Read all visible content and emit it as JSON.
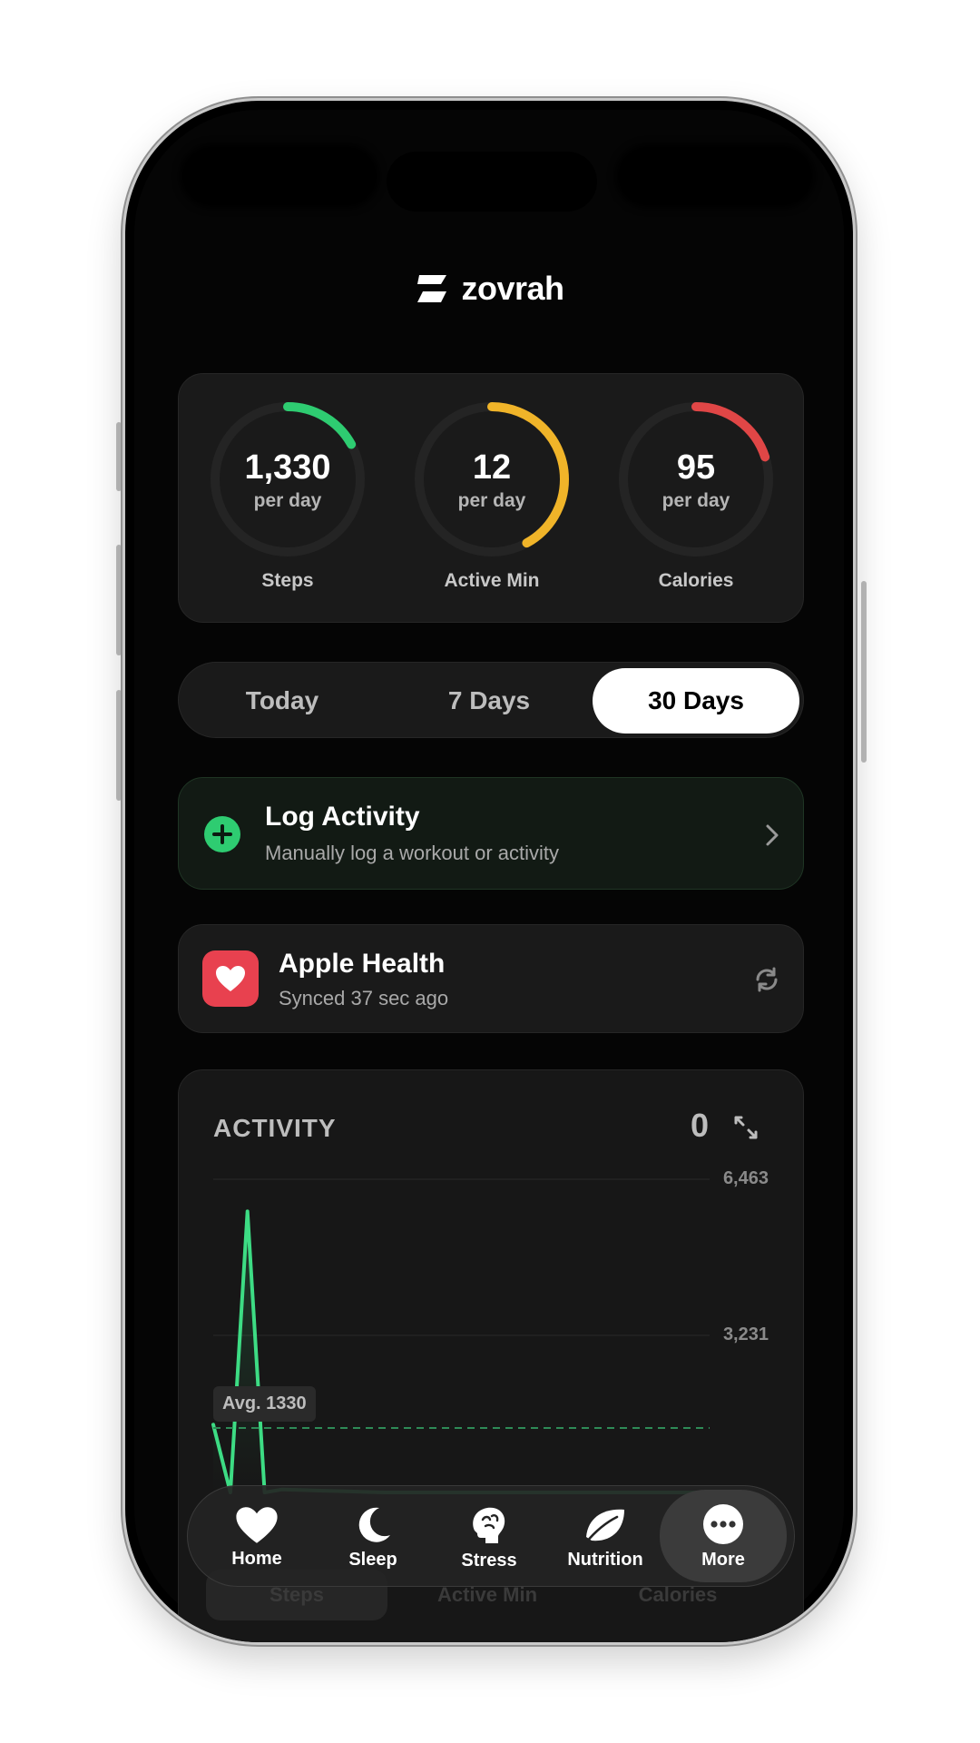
{
  "app": {
    "logo_text": "zovrah"
  },
  "rings": [
    {
      "value": "1,330",
      "unit": "per day",
      "label": "Steps",
      "progress": 0.17,
      "color": "#2ecc71"
    },
    {
      "value": "12",
      "unit": "per day",
      "label": "Active Min",
      "progress": 0.42,
      "color": "#f0b429"
    },
    {
      "value": "95",
      "unit": "per day",
      "label": "Calories",
      "progress": 0.2,
      "color": "#e04646"
    }
  ],
  "range_tabs": [
    {
      "label": "Today",
      "active": false
    },
    {
      "label": "7 Days",
      "active": false
    },
    {
      "label": "30 Days",
      "active": true
    }
  ],
  "log_activity": {
    "title": "Log Activity",
    "subtitle": "Manually log a workout or activity",
    "accent": "#2ecc71"
  },
  "apple_health": {
    "title": "Apple Health",
    "subtitle": "Synced 37 sec ago",
    "icon_bg": "#e8414f"
  },
  "activity": {
    "title": "ACTIVITY",
    "count": "0",
    "ticks": [
      "6,463",
      "3,231"
    ],
    "avg_label": "Avg. 1330",
    "metric_tabs": [
      "Steps",
      "Active Min",
      "Calories"
    ]
  },
  "chart_data": {
    "type": "line",
    "x": [
      1,
      2,
      3,
      4,
      5,
      6,
      7,
      8,
      9,
      10,
      11,
      12,
      13,
      14,
      15,
      16,
      17,
      18,
      19,
      20,
      21,
      22,
      23,
      24,
      25,
      26,
      27,
      28,
      29,
      30
    ],
    "series": [
      {
        "values": [
          1400,
          0,
          5800,
          0,
          60,
          50,
          40,
          30,
          20,
          10,
          0,
          0,
          0,
          0,
          0,
          0,
          0,
          0,
          0,
          0,
          0,
          0,
          0,
          0,
          0,
          0,
          0,
          0,
          0,
          0
        ],
        "color": "#3ddc84"
      }
    ],
    "average": 1330,
    "ylim": [
      0,
      6463
    ],
    "yticks": [
      6463,
      3231
    ],
    "grid": true
  },
  "nav": [
    {
      "label": "Home",
      "icon": "heart-icon",
      "active": false
    },
    {
      "label": "Sleep",
      "icon": "moon-icon",
      "active": false
    },
    {
      "label": "Stress",
      "icon": "brain-icon",
      "active": false
    },
    {
      "label": "Nutrition",
      "icon": "leaf-icon",
      "active": false
    },
    {
      "label": "More",
      "icon": "more-icon",
      "active": true
    }
  ]
}
